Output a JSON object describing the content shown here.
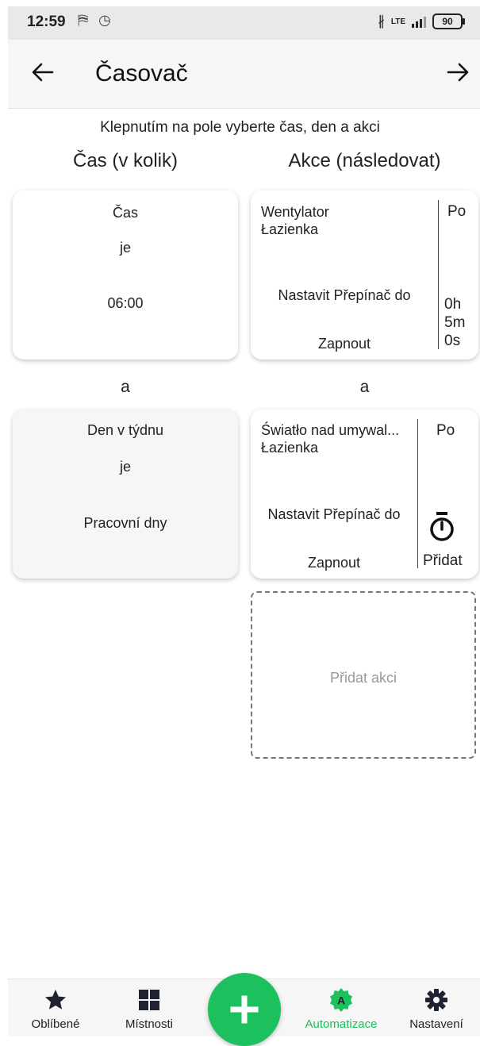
{
  "status_bar": {
    "time": "12:59",
    "left_icons": "⛿ ◷",
    "lte": "LTE",
    "battery": "90"
  },
  "header": {
    "title": "Časovač"
  },
  "hint": "Klepnutím na pole vyberte čas, den a akci",
  "columns": {
    "left_title": "Čas (v kolik)",
    "right_title": "Akce (následovat)"
  },
  "conditions": [
    {
      "title": "Čas",
      "op": "je",
      "value": "06:00"
    },
    {
      "title": "Den v týdnu",
      "op": "je",
      "value": "Pracovní dny"
    }
  ],
  "and_label": "a",
  "actions": [
    {
      "device": "Wentylator",
      "room": "Łazienka",
      "action": "Nastavit Přepínač do",
      "state": "Zapnout",
      "after_label": "Po",
      "delay_h": "0h",
      "delay_m": "5m",
      "delay_s": "0s"
    },
    {
      "device": "Światło nad umywal...",
      "room": "Łazienka",
      "action": "Nastavit Přepínač do",
      "state": "Zapnout",
      "after_label": "Po",
      "add_delay_label": "Přidat"
    }
  ],
  "add_action_label": "Přidat akci",
  "nav": {
    "favorites": "Oblíbené",
    "rooms": "Místnosti",
    "automation": "Automatizace",
    "automation_badge": "A",
    "settings": "Nastavení",
    "active_color": "#1cc05c",
    "icon_color": "#1f2233"
  }
}
